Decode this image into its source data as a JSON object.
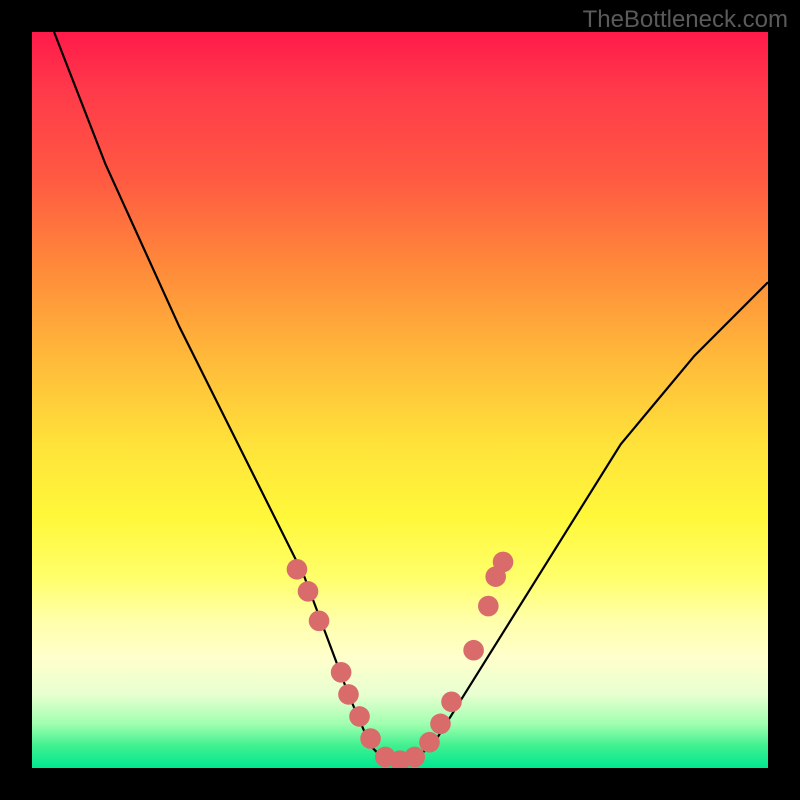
{
  "watermark": "TheBottleneck.com",
  "chart_data": {
    "type": "line",
    "title": "",
    "xlabel": "",
    "ylabel": "",
    "xlim": [
      0,
      100
    ],
    "ylim": [
      0,
      100
    ],
    "series": [
      {
        "name": "bottleneck-curve",
        "x": [
          3,
          10,
          20,
          30,
          37,
          40,
          43,
          46,
          48,
          52,
          55,
          60,
          70,
          80,
          90,
          100
        ],
        "y": [
          100,
          82,
          60,
          40,
          26,
          18,
          10,
          3,
          1,
          1,
          4,
          12,
          28,
          44,
          56,
          66
        ]
      }
    ],
    "markers": {
      "name": "highlight-points",
      "color": "#d96b6b",
      "points": [
        {
          "x": 36,
          "y": 27
        },
        {
          "x": 37.5,
          "y": 24
        },
        {
          "x": 39,
          "y": 20
        },
        {
          "x": 42,
          "y": 13
        },
        {
          "x": 43,
          "y": 10
        },
        {
          "x": 44.5,
          "y": 7
        },
        {
          "x": 46,
          "y": 4
        },
        {
          "x": 48,
          "y": 1.5
        },
        {
          "x": 50,
          "y": 1
        },
        {
          "x": 52,
          "y": 1.5
        },
        {
          "x": 54,
          "y": 3.5
        },
        {
          "x": 55.5,
          "y": 6
        },
        {
          "x": 57,
          "y": 9
        },
        {
          "x": 60,
          "y": 16
        },
        {
          "x": 62,
          "y": 22
        },
        {
          "x": 63,
          "y": 26
        },
        {
          "x": 64,
          "y": 28
        }
      ]
    }
  }
}
